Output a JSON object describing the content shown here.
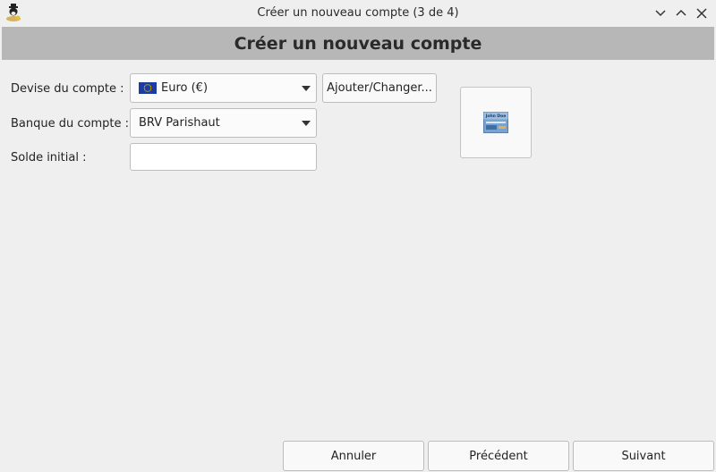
{
  "window": {
    "title": "Créer un nouveau compte (3 de 4)"
  },
  "banner": {
    "title": "Créer un nouveau compte"
  },
  "form": {
    "currency_label": "Devise du compte :",
    "currency_value": "Euro (€)",
    "currency_flag_icon": "eu-flag-icon",
    "add_change_button": "Ajouter/Changer...",
    "bank_label": "Banque du compte :",
    "bank_value": "BRV Parishaut",
    "opening_balance_label": "Solde initial :",
    "opening_balance_value": ""
  },
  "card_icon": {
    "name": "John Doe"
  },
  "footer": {
    "cancel": "Annuler",
    "previous": "Précédent",
    "next": "Suivant"
  },
  "colors": {
    "banner_bg": "#b7b7b7",
    "window_bg": "#efefef",
    "eu_blue": "#1c3ba3",
    "eu_star": "#f5d000"
  }
}
